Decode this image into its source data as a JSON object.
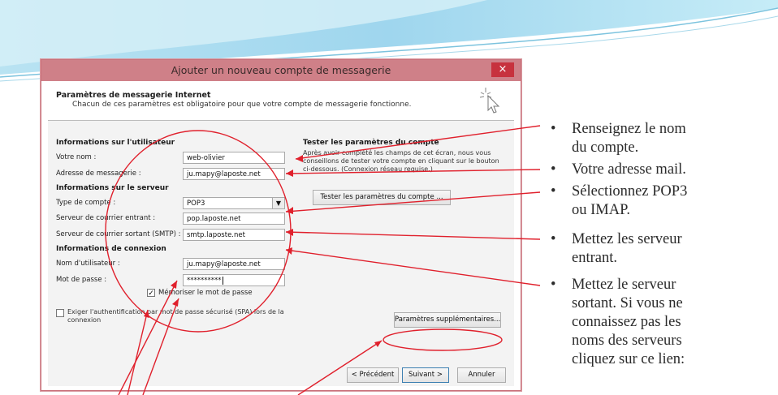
{
  "dialog": {
    "title": "Ajouter un nouveau compte de messagerie",
    "close_glyph": "×",
    "header_title": "Paramètres de messagerie Internet",
    "header_subtitle": "Chacun de ces paramètres est obligatoire pour que votre compte de messagerie fonctionne."
  },
  "user_section": {
    "heading": "Informations sur l'utilisateur",
    "name_label": "Votre nom :",
    "name_value": "web-olivier",
    "email_label": "Adresse de messagerie :",
    "email_value": "ju.mapy@laposte.net"
  },
  "server_section": {
    "heading": "Informations sur le serveur",
    "account_type_label": "Type de compte :",
    "account_type_value": "POP3",
    "incoming_label": "Serveur de courrier entrant :",
    "incoming_value": "pop.laposte.net",
    "outgoing_label": "Serveur de courrier sortant (SMTP) :",
    "outgoing_value": "smtp.laposte.net"
  },
  "logon_section": {
    "heading": "Informations de connexion",
    "username_label": "Nom d'utilisateur :",
    "username_value": "ju.mapy@laposte.net",
    "password_label": "Mot de passe :",
    "password_value": "**********",
    "remember_label": "Mémoriser le mot de passe",
    "remember_checked": true,
    "spa_label": "Exiger l'authentification par mot de passe sécurisé (SPA) lors de la connexion",
    "spa_checked": false
  },
  "test_section": {
    "heading": "Tester les paramètres du compte",
    "description": "Après avoir complété les champs de cet écran, nous vous conseillons de tester votre compte en cliquant sur le bouton ci-dessous. (Connexion réseau requise.)",
    "test_button": "Tester les paramètres du compte ..."
  },
  "buttons": {
    "more_settings": "Paramètres supplémentaires...",
    "previous": "< Précédent",
    "next": "Suivant >",
    "cancel": "Annuler"
  },
  "instructions": {
    "bullet": "•",
    "items": [
      [
        "Renseignez le nom",
        "du compte."
      ],
      [
        "Votre adresse mail."
      ],
      [
        "Sélectionnez POP3",
        "ou IMAP."
      ],
      [
        "Mettez les serveur",
        "entrant."
      ],
      [
        "Mettez le serveur",
        "sortant. Si vous ne",
        "connaissez pas les",
        "noms des serveurs",
        "cliquez sur ce lien:"
      ]
    ]
  },
  "colors": {
    "annotation_red": "#e0202c",
    "titlebar": "#cf8088",
    "close_button": "#c7323e"
  },
  "icons": {
    "wizard_icon": "cursor-sparkle",
    "dropdown_icon": "chevron-down",
    "check_icon": "checkmark"
  }
}
